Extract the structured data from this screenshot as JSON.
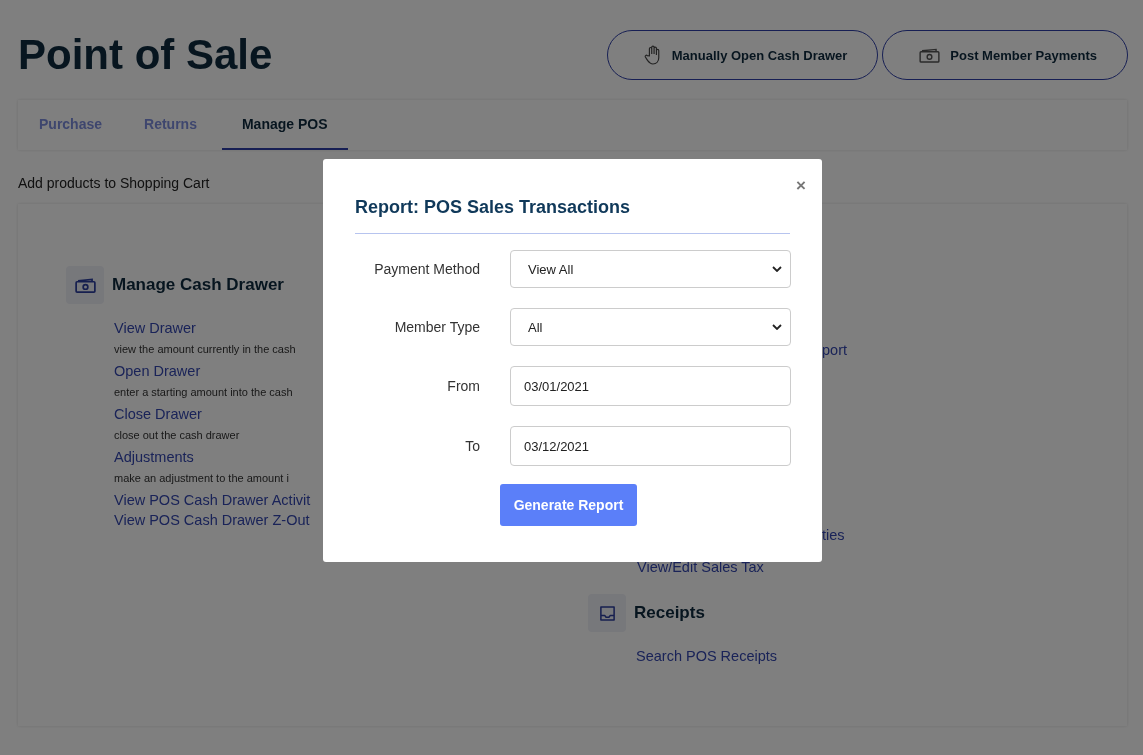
{
  "page": {
    "title": "Point of Sale",
    "header_buttons": [
      {
        "label": "Manually Open Cash Drawer"
      },
      {
        "label": "Post Member Payments"
      }
    ]
  },
  "tabs": [
    {
      "label": "Purchase",
      "selected": false
    },
    {
      "label": "Returns",
      "selected": false
    },
    {
      "label": "Manage POS",
      "selected": true
    }
  ],
  "subtitle": "Add products to Shopping Cart",
  "cash_drawer": {
    "title": "Manage Cash Drawer",
    "items": [
      {
        "kind": "link",
        "text": "View Drawer"
      },
      {
        "kind": "note",
        "text": "view the amount currently in the cash"
      },
      {
        "kind": "link",
        "text": "Open Drawer"
      },
      {
        "kind": "note",
        "text": "enter a starting amount into the cash"
      },
      {
        "kind": "link",
        "text": "Close Drawer"
      },
      {
        "kind": "note",
        "text": "close out the cash drawer"
      },
      {
        "kind": "link",
        "text": "Adjustments"
      },
      {
        "kind": "note",
        "text": "make an adjustment to the amount i"
      },
      {
        "kind": "link",
        "text": "View POS Cash Drawer Activit"
      },
      {
        "kind": "link",
        "text": "View POS Cash Drawer Z-Out"
      }
    ]
  },
  "right_column": {
    "partial_links": [
      "port",
      "ties",
      "View/Edit Sales Tax"
    ],
    "receipts": {
      "title": "Receipts",
      "items": [
        {
          "kind": "link",
          "text": "Search POS Receipts"
        }
      ]
    }
  },
  "modal": {
    "title": "Report: POS Sales Transactions",
    "close": "×",
    "fields": [
      {
        "label": "Payment Method",
        "kind": "select",
        "value": "View All"
      },
      {
        "label": "Member Type",
        "kind": "select",
        "value": "All"
      },
      {
        "label": "From",
        "kind": "date",
        "value": "03/01/2021"
      },
      {
        "label": "To",
        "kind": "date",
        "value": "03/12/2021"
      }
    ],
    "button": "Generate Report"
  }
}
